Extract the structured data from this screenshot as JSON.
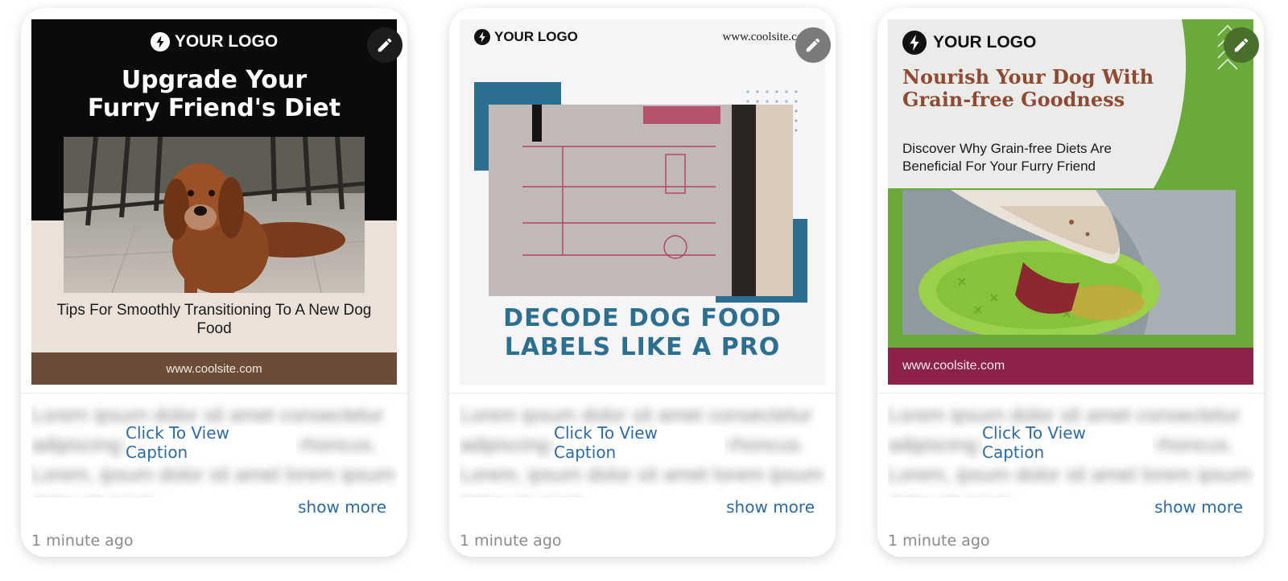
{
  "cards": [
    {
      "poster": {
        "logo": "YOUR LOGO",
        "title_line1": "Upgrade Your",
        "title_line2": "Furry Friend's Diet",
        "subtitle": "Tips For Smoothly Transitioning To A New Dog Food",
        "footer": "www.coolsite.com"
      },
      "caption_blur": "Lorem ipsum dolor sit amet consectetur adipiscing vitae mollis tempor rhoncus. Lorem, ipsum dolor sit amet lorem ipsum dolor sit amet",
      "caption_button": "Click To View Caption",
      "show_more": "show more",
      "timestamp": "1 minute ago"
    },
    {
      "poster": {
        "logo": "YOUR LOGO",
        "url": "www.coolsite.com",
        "title_line1": "DECODE DOG FOOD",
        "title_line2": "LABELS LIKE A PRO"
      },
      "caption_blur": "Lorem ipsum dolor sit amet consectetur adipiscing vitae mollis tempor rhoncus. Lorem, ipsum dolor sit amet lorem ipsum dolor sit amet",
      "caption_button": "Click To View Caption",
      "show_more": "show more",
      "timestamp": "1 minute ago"
    },
    {
      "poster": {
        "logo": "YOUR LOGO",
        "title_line1": "Nourish Your Dog With",
        "title_line2": "Grain-free Goodness",
        "subtitle": "Discover Why Grain-free Diets Are Beneficial For Your Furry Friend",
        "footer": "www.coolsite.com"
      },
      "caption_blur": "Lorem ipsum dolor sit amet consectetur adipiscing vitae mollis tempor rhoncus. Lorem, ipsum dolor sit amet lorem ipsum dolor sit amet",
      "caption_button": "Click To View Caption",
      "show_more": "show more",
      "timestamp": "1 minute ago"
    }
  ],
  "icons": {
    "edit": "pencil-icon",
    "logo": "lightning-bolt-icon"
  },
  "colors": {
    "link": "#2d6aa0",
    "poster1_footer": "#6b4c38",
    "poster2_title": "#2d6f8e",
    "poster3_green": "#6aaa3a",
    "poster3_footer": "#8c2149",
    "poster3_title": "#8e4a33"
  }
}
